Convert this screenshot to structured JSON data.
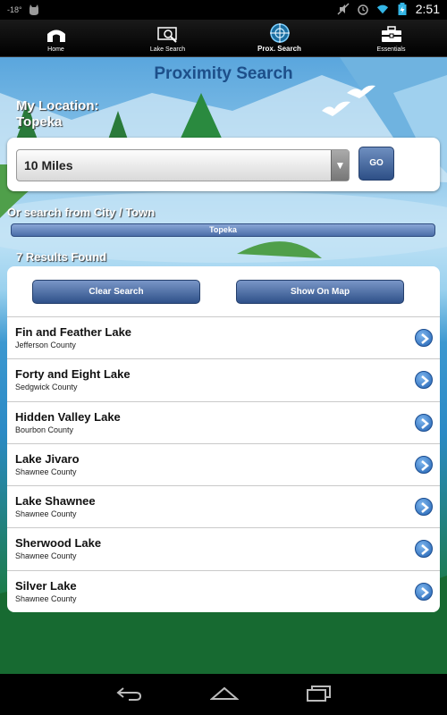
{
  "status_bar": {
    "temperature": "-18°",
    "time": "2:51",
    "icons": [
      "cat-icon",
      "mute-icon",
      "alarm-icon",
      "wifi-icon",
      "battery-icon"
    ]
  },
  "nav": {
    "tabs": [
      {
        "label": "Home",
        "icon": "home-icon",
        "active": false
      },
      {
        "label": "Lake Search",
        "icon": "lake-search-icon",
        "active": false
      },
      {
        "label": "Prox. Search",
        "icon": "crosshair-icon",
        "active": true
      },
      {
        "label": "Essentials",
        "icon": "toolbox-icon",
        "active": false
      }
    ]
  },
  "page": {
    "title": "Proximity Search",
    "my_location_label": "My Location:",
    "my_location_value": "Topeka",
    "distance_selected": "10 Miles",
    "go_label": "GO",
    "city_label": "Or search from City / Town",
    "city_value": "Topeka",
    "results_count": "7 Results Found",
    "clear_label": "Clear Search",
    "map_label": "Show On Map"
  },
  "results": [
    {
      "name": "Fin and Feather Lake",
      "county": "Jefferson County"
    },
    {
      "name": "Forty and Eight Lake",
      "county": "Sedgwick County"
    },
    {
      "name": "Hidden Valley Lake",
      "county": "Bourbon County"
    },
    {
      "name": "Lake Jivaro",
      "county": "Shawnee County"
    },
    {
      "name": "Lake Shawnee",
      "county": "Shawnee County"
    },
    {
      "name": "Sherwood Lake",
      "county": "Shawnee County"
    },
    {
      "name": "Silver Lake",
      "county": "Shawnee County"
    }
  ],
  "colors": {
    "accent": "#1d4f8a",
    "button": "#2f5189",
    "background_water": "#3c98d0",
    "background_grass": "#1a7a3c"
  }
}
